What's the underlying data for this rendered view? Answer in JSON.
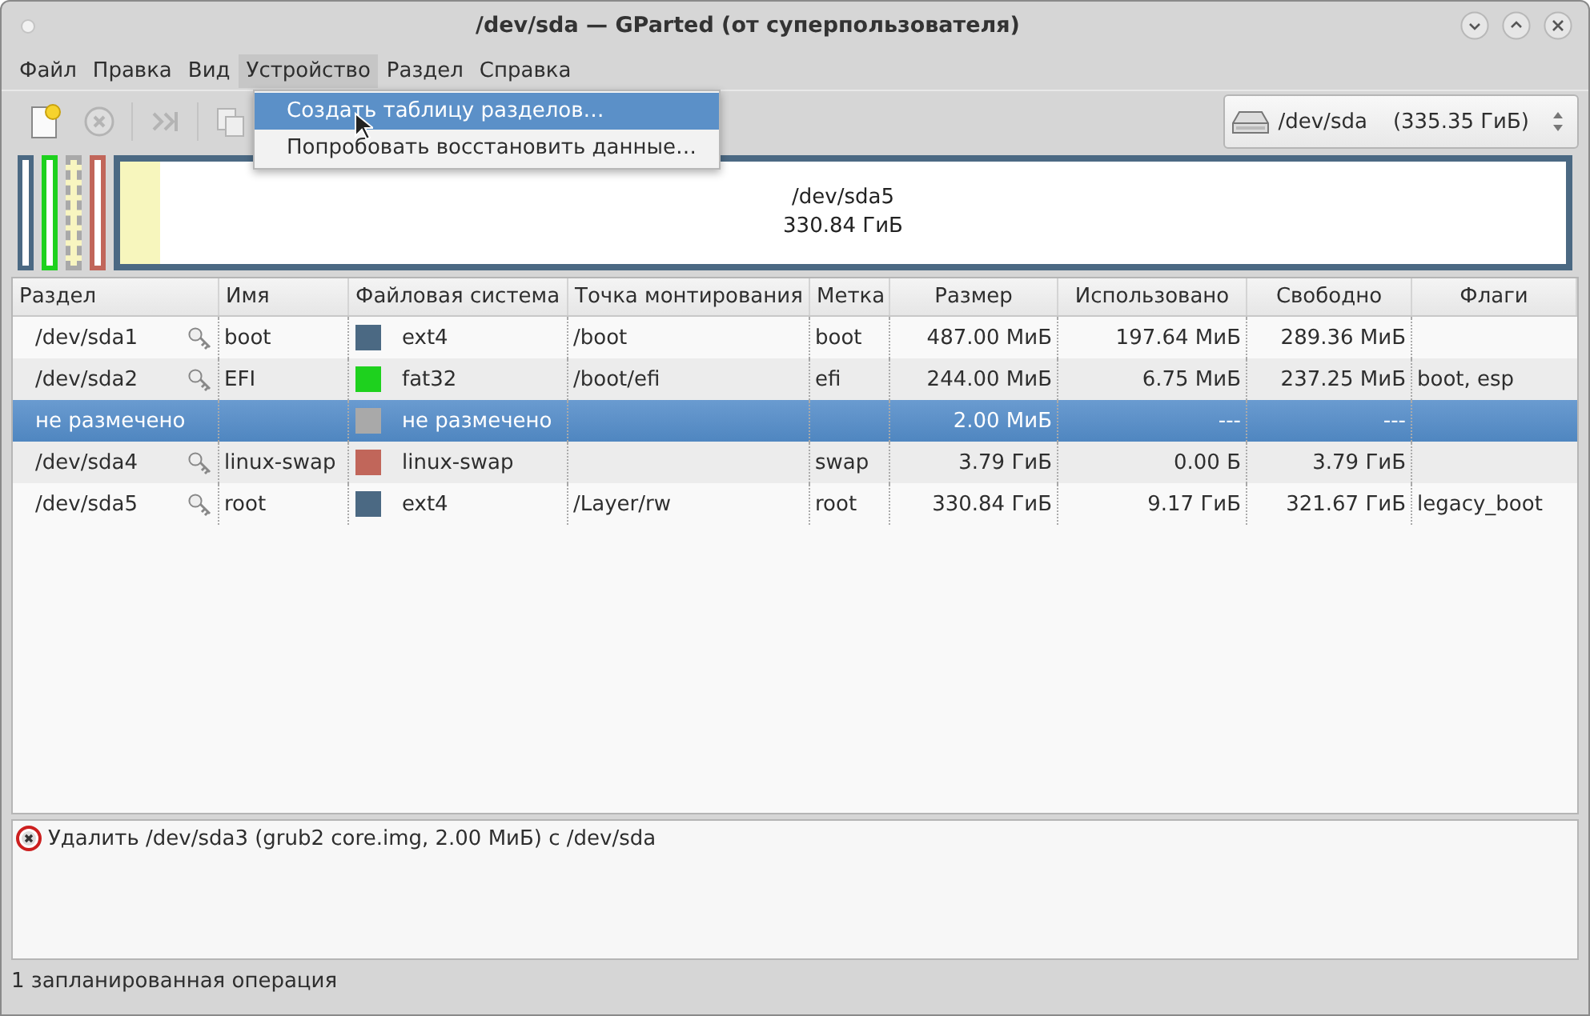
{
  "window": {
    "title": "/dev/sda — GParted (от суперпользователя)"
  },
  "menu_bar": [
    {
      "label": "Файл",
      "selected": false
    },
    {
      "label": "Правка",
      "selected": false
    },
    {
      "label": "Вид",
      "selected": false
    },
    {
      "label": "Устройство",
      "selected": true
    },
    {
      "label": "Раздел",
      "selected": false
    },
    {
      "label": "Справка",
      "selected": false
    }
  ],
  "device_menu": [
    {
      "label": "Создать таблицу разделов…",
      "selected": true
    },
    {
      "label": "Попробовать восстановить данные…",
      "selected": false
    }
  ],
  "toolbar": [
    {
      "kind": "new",
      "disabled": false
    },
    {
      "kind": "undo",
      "disabled": true
    },
    {
      "kind": "apply",
      "disabled": true
    },
    {
      "kind": "copy",
      "disabled": true
    }
  ],
  "device_selector": {
    "device": "/dev/sda",
    "size": "(335.35 ГиБ)"
  },
  "disk_map": [
    {
      "kind": "partition",
      "color": "#4b6983"
    },
    {
      "kind": "partition",
      "color": "#1ed11e"
    },
    {
      "kind": "unallocated",
      "color": "#a9a9a9"
    },
    {
      "kind": "partition",
      "color": "#c1665a"
    },
    {
      "kind": "partition",
      "color": "#4b6983",
      "level": 0.028,
      "name": "/dev/sda5",
      "size": "330.84 ГиБ"
    }
  ],
  "table": {
    "columns": [
      "Раздел",
      "Имя",
      "Файловая система",
      "Точка монтирования",
      "Метка",
      "Размер",
      "Использовано",
      "Свободно",
      "Флаги"
    ],
    "rows": [
      {
        "partition": "/dev/sda1",
        "locked": true,
        "name": "boot",
        "color": "#4b6983",
        "filesystem": "ext4",
        "mount": "/boot",
        "label": "boot",
        "size": "487.00 МиБ",
        "used": "197.64 МиБ",
        "free": "289.36 МиБ",
        "flags": "",
        "selected": false
      },
      {
        "partition": "/dev/sda2",
        "locked": true,
        "name": "EFI",
        "color": "#1ed11e",
        "filesystem": "fat32",
        "mount": "/boot/efi",
        "label": "efi",
        "size": "244.00 МиБ",
        "used": "6.75 МиБ",
        "free": "237.25 МиБ",
        "flags": "boot, esp",
        "selected": false
      },
      {
        "partition": "не размечено",
        "locked": false,
        "name": "",
        "color": "#a9a9a9",
        "filesystem": "не размечено",
        "mount": "",
        "label": "",
        "size": "2.00 МиБ",
        "used": "---",
        "free": "---",
        "flags": "",
        "selected": true
      },
      {
        "partition": "/dev/sda4",
        "locked": true,
        "name": "linux-swap",
        "color": "#c1665a",
        "filesystem": "linux-swap",
        "mount": "",
        "label": "swap",
        "size": "3.79 ГиБ",
        "used": "0.00 Б",
        "free": "3.79 ГиБ",
        "flags": "",
        "selected": false
      },
      {
        "partition": "/dev/sda5",
        "locked": true,
        "name": "root",
        "color": "#4b6983",
        "filesystem": "ext4",
        "mount": "/Layer/rw",
        "label": "root",
        "size": "330.84 ГиБ",
        "used": "9.17 ГиБ",
        "free": "321.67 ГиБ",
        "flags": "legacy_boot",
        "selected": false
      }
    ]
  },
  "operations": [
    {
      "kind": "delete",
      "text": "Удалить /dev/sda3 (grub2 core.img, 2.00 МиБ) с /dev/sda"
    }
  ],
  "status_bar": "1 запланированная операция"
}
